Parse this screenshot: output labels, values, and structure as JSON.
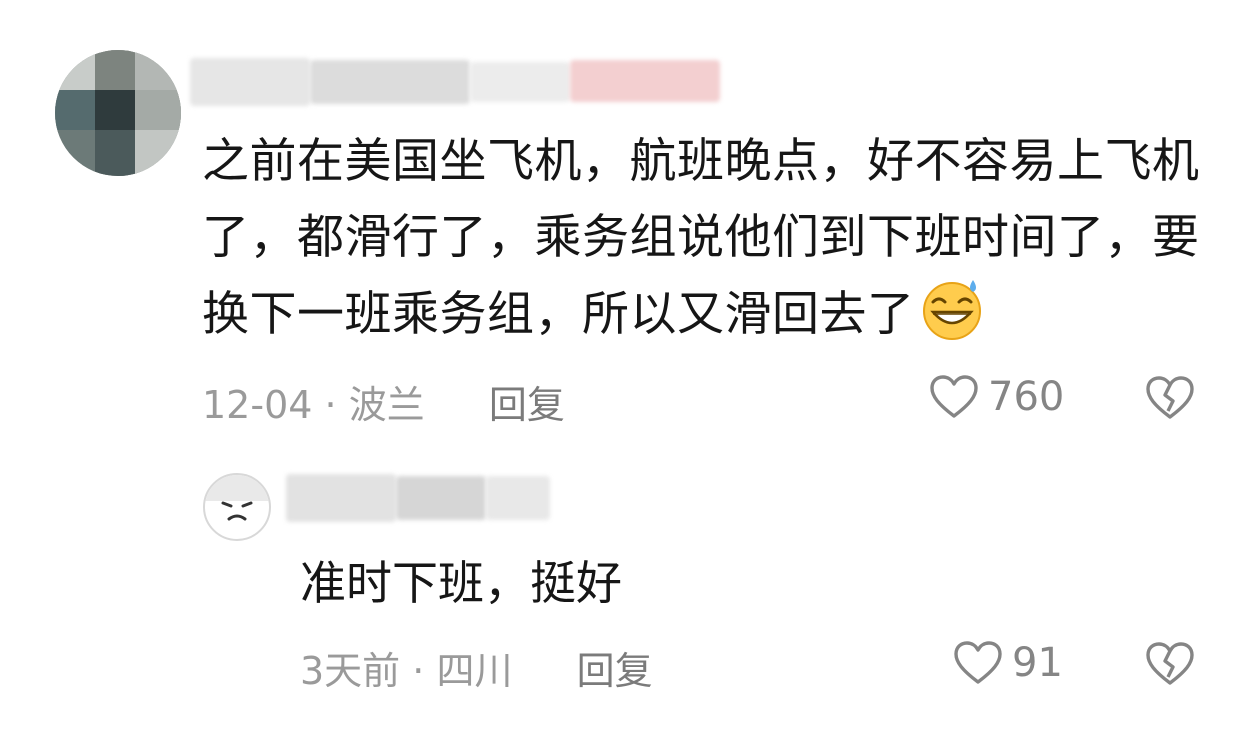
{
  "comment": {
    "text": "之前在美国坐飞机，航班晚点，好不容易上飞机了，都滑行了，乘务组说他们到下班时间了，要换下一班乘务组，所以又滑回去了",
    "emoji": "sweat-smile-emoji",
    "date": "12-04",
    "separator": "·",
    "location": "波兰",
    "reply_label": "回复",
    "likes": "760"
  },
  "reply": {
    "text": "准时下班，挺好",
    "date": "3天前",
    "separator": "·",
    "location": "四川",
    "reply_label": "回复",
    "likes": "91"
  },
  "colors": {
    "meta_text": "#9a9a9a",
    "body_text": "#161616",
    "icon": "#858585"
  }
}
